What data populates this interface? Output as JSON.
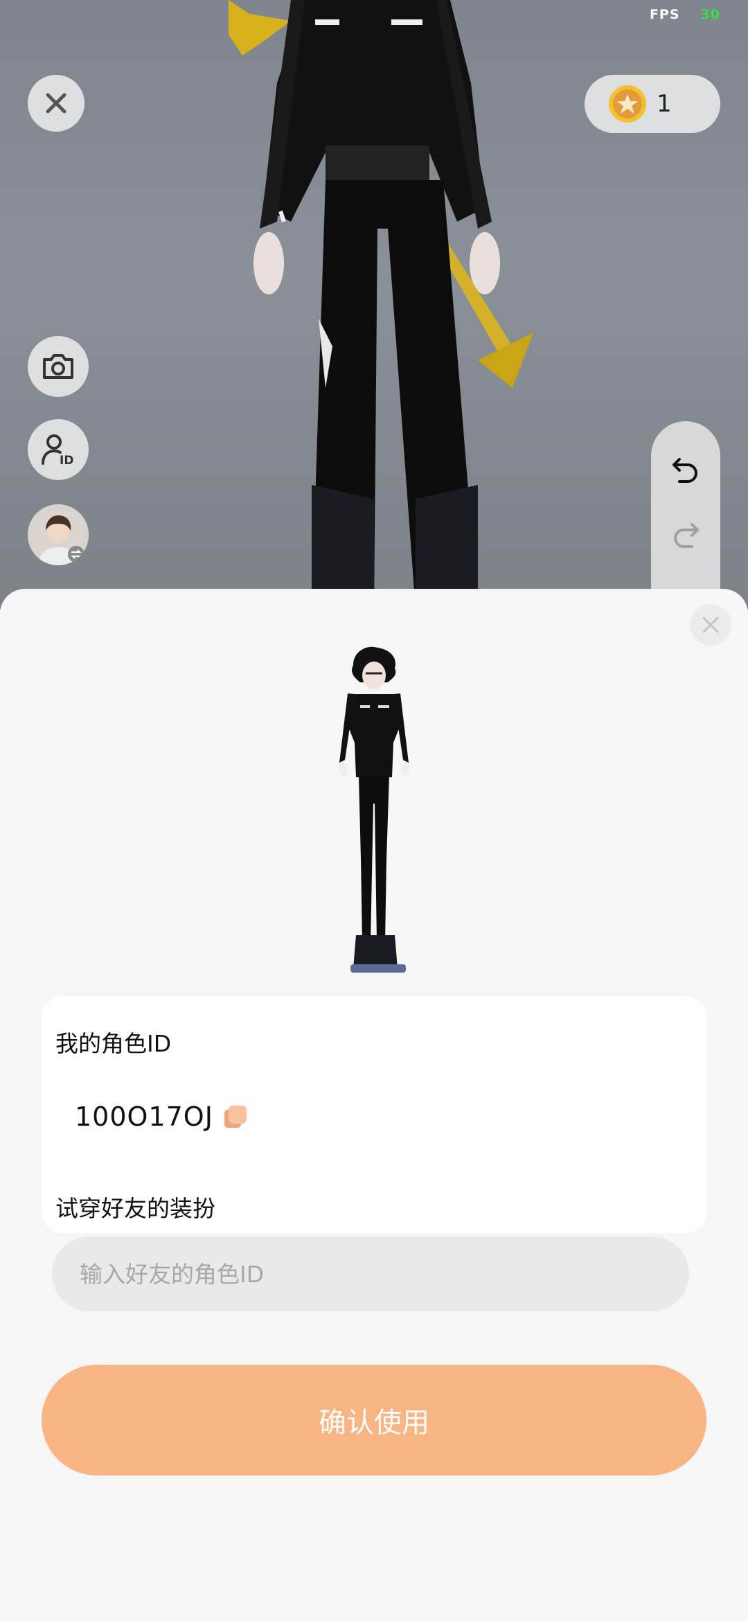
{
  "status": {
    "fps_label": "FPS",
    "fps_value": "30"
  },
  "top_bar": {
    "coin_count": "1"
  },
  "icons": {
    "close": "close-icon",
    "coin": "star-coin-icon",
    "camera": "camera-icon",
    "role_id": "user-id-icon",
    "avatar": "avatar-swap-icon",
    "undo": "undo-icon",
    "redo": "redo-icon",
    "copy": "copy-icon"
  },
  "sheet": {
    "my_id_label": "我的角色ID",
    "my_id_value": "100O17OJ",
    "try_label": "试穿好友的装扮",
    "input_placeholder": "输入好友的角色ID",
    "input_value": "",
    "confirm_label": "确认使用"
  },
  "colors": {
    "accent": "#f8b583",
    "fps_value": "#35e04a",
    "input_bg": "#e9e9e9"
  }
}
